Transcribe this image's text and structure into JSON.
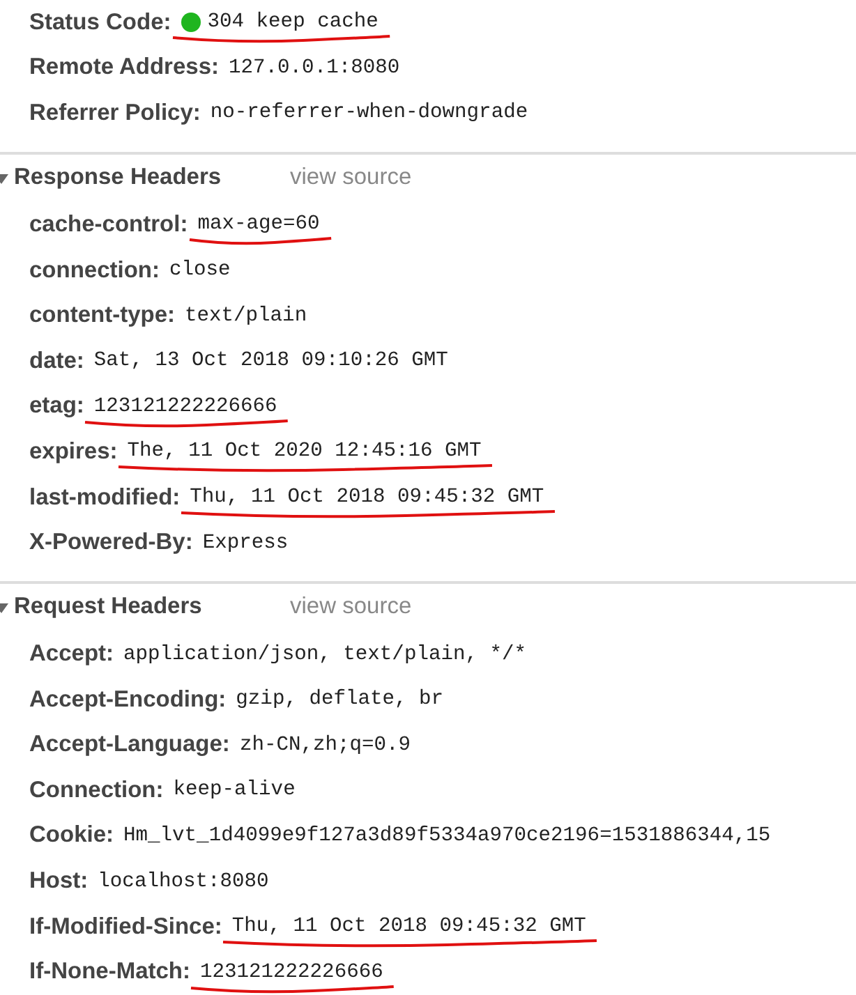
{
  "general": [
    {
      "name": "Status Code:",
      "value": "304 keep cache",
      "color": "#1fb51f",
      "underlined": true
    },
    {
      "name": "Remote Address:",
      "value": "127.0.0.1:8080"
    },
    {
      "name": "Referrer Policy:",
      "value": "no-referrer-when-downgrade"
    }
  ],
  "sections": [
    {
      "title": "Response Headers",
      "link": "view source",
      "expanded": true,
      "headers": [
        {
          "name": "cache-control:",
          "value": "max-age=60",
          "underlined": true
        },
        {
          "name": "connection:",
          "value": "close"
        },
        {
          "name": "content-type:",
          "value": "text/plain"
        },
        {
          "name": "date:",
          "value": "Sat, 13 Oct 2018 09:10:26 GMT"
        },
        {
          "name": "etag:",
          "value": "123121222226666",
          "underlined": true
        },
        {
          "name": "expires:",
          "value": "The, 11 Oct 2020 12:45:16 GMT",
          "underlined": true
        },
        {
          "name": "last-modified:",
          "value": "Thu, 11 Oct 2018 09:45:32 GMT",
          "underlined": true
        },
        {
          "name": "X-Powered-By:",
          "value": "Express"
        }
      ]
    },
    {
      "title": "Request Headers",
      "link": "view source",
      "expanded": true,
      "headers": [
        {
          "name": "Accept:",
          "value": "application/json, text/plain, */*"
        },
        {
          "name": "Accept-Encoding:",
          "value": "gzip, deflate, br"
        },
        {
          "name": "Accept-Language:",
          "value": "zh-CN,zh;q=0.9"
        },
        {
          "name": "Connection:",
          "value": "keep-alive"
        },
        {
          "name": "Cookie:",
          "value": "Hm_lvt_1d4099e9f127a3d89f5334a970ce2196=1531886344,15"
        },
        {
          "name": "Host:",
          "value": "localhost:8080"
        },
        {
          "name": "If-Modified-Since:",
          "value": "Thu, 11 Oct 2018 09:45:32 GMT",
          "underlined": true
        },
        {
          "name": "If-None-Match:",
          "value": "123121222226666",
          "underlined": true
        }
      ]
    }
  ]
}
